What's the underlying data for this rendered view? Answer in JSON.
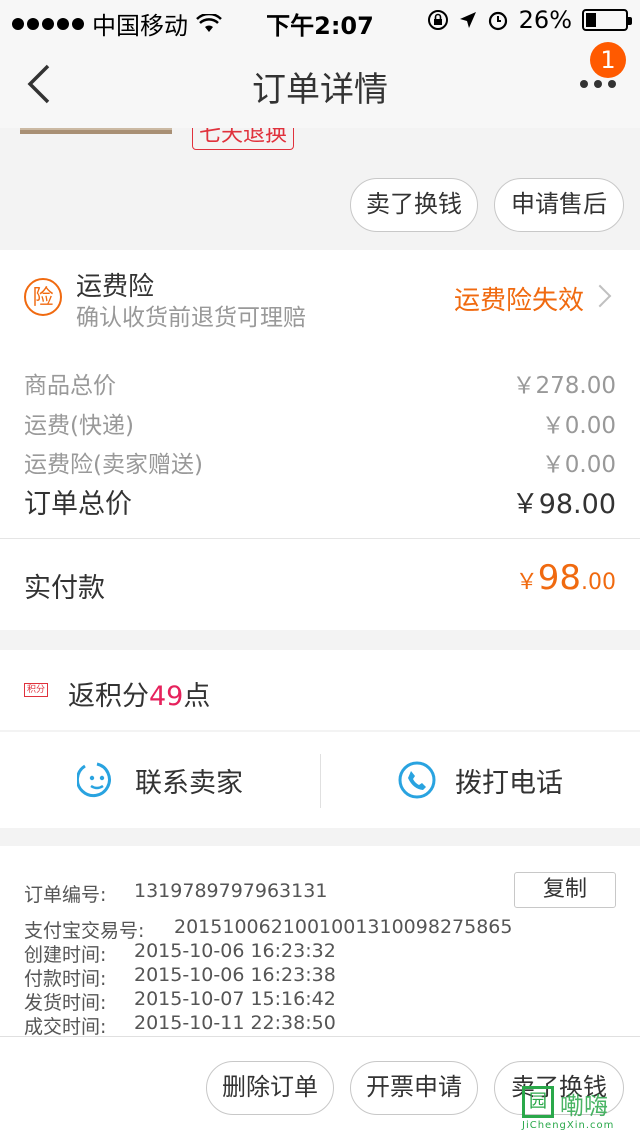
{
  "status_bar": {
    "carrier": "中国移动",
    "time": "下午2:07",
    "battery": "26%"
  },
  "nav": {
    "title": "订单详情",
    "badge": "1"
  },
  "product": {
    "tag": "七天退换"
  },
  "actions_top": {
    "sell": "卖了换钱",
    "after_sale": "申请售后"
  },
  "insurance": {
    "icon_text": "险",
    "title": "运费险",
    "subtitle": "确认收货前退货可理赔",
    "status": "运费险失效"
  },
  "price": {
    "goods_label": "商品总价",
    "goods_value": "￥278.00",
    "shipping_label": "运费(快递)",
    "shipping_value": "￥0.00",
    "insurance_label": "运费险(卖家赠送)",
    "insurance_value": "￥0.00",
    "total_label": "订单总价",
    "total_value": "￥98.00"
  },
  "paid": {
    "label": "实付款",
    "symbol": "￥",
    "integer": "98",
    "decimal": ".00"
  },
  "points": {
    "icon_text": "积分",
    "prefix": "返积分",
    "number": "49",
    "suffix": "点"
  },
  "contact": {
    "seller": "联系卖家",
    "phone": "拨打电话"
  },
  "order_info": {
    "copy": "复制",
    "items": [
      {
        "key": "订单编号:",
        "value": "1319789797963131"
      },
      {
        "key": "支付宝交易号:",
        "value": "2015100621001001310098275865"
      },
      {
        "key": "创建时间:",
        "value": "2015-10-06 16:23:32"
      },
      {
        "key": "付款时间:",
        "value": "2015-10-06 16:23:38"
      },
      {
        "key": "发货时间:",
        "value": "2015-10-07 15:16:42"
      },
      {
        "key": "成交时间:",
        "value": "2015-10-11 22:38:50"
      }
    ]
  },
  "bottom_actions": {
    "delete": "删除订单",
    "invoice": "开票申请",
    "sell": "卖了换钱"
  },
  "watermark": {
    "logo": "园",
    "text": "嘞嗨",
    "domain": "JiChengXin.com"
  },
  "colors": {
    "accent": "#f06a10",
    "points": "#e6225c",
    "tag": "#e0313c",
    "contact_icon": "#29a3e0"
  }
}
